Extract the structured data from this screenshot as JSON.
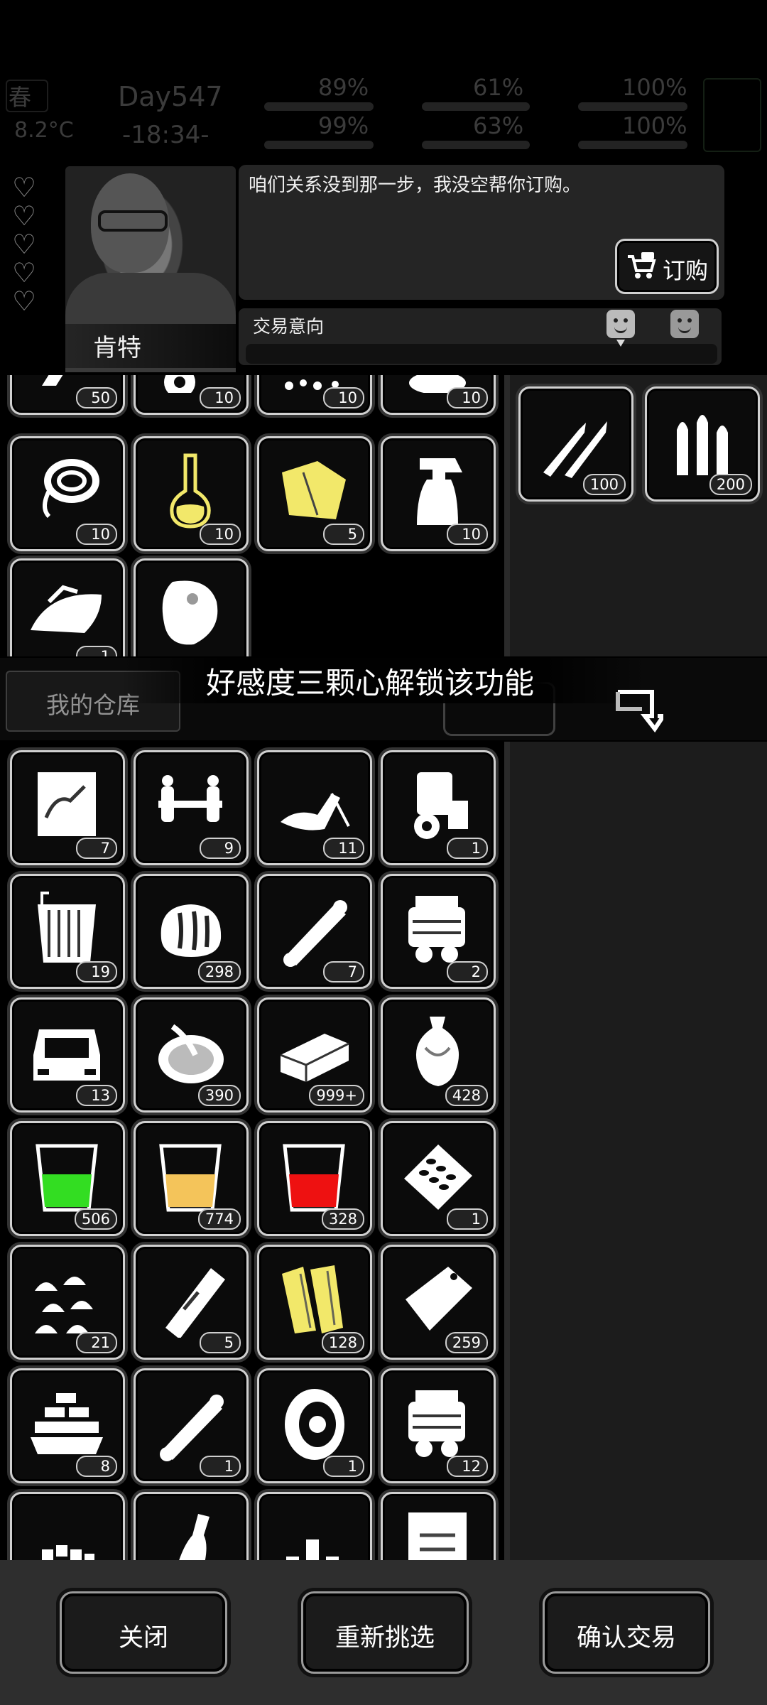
{
  "hud": {
    "season": "春",
    "temperature": "8.2°C",
    "day": "Day547",
    "time": "-18:34-",
    "stats": [
      "89%",
      "61%",
      "100%",
      "99%",
      "63%",
      "100%"
    ]
  },
  "npc": {
    "name": "肯特",
    "hearts_total": 5,
    "dialog": "咱们关系没到那一步，我没空帮你订购。",
    "order_label": "订购",
    "intent_label": "交易意向"
  },
  "npc_items": {
    "counts_top_partial": [
      "50",
      "10",
      "10",
      "10"
    ],
    "row2": [
      {
        "icon": "rope-icon",
        "count": "10"
      },
      {
        "icon": "flask-icon",
        "count": "10"
      },
      {
        "icon": "cloth-icon",
        "count": "5"
      },
      {
        "icon": "spray-bottle-icon",
        "count": "10"
      }
    ],
    "row3": [
      {
        "icon": "iron-icon",
        "count": "1"
      },
      {
        "icon": "meat-icon",
        "count": ""
      }
    ]
  },
  "npc_offer": [
    {
      "icon": "rifle-ammo-icon",
      "count": "100"
    },
    {
      "icon": "bullets-icon",
      "count": "200"
    }
  ],
  "banner": {
    "text": "好感度三颗心解锁该功能",
    "warehouse_label": "我的仓库"
  },
  "my_items": [
    {
      "icon": "blueprint-icon",
      "count": "7"
    },
    {
      "icon": "axle-icon",
      "count": "9"
    },
    {
      "icon": "motorcycle-part-icon",
      "count": "11"
    },
    {
      "icon": "engine-icon",
      "count": "1"
    },
    {
      "icon": "radiator-icon",
      "count": "19"
    },
    {
      "icon": "bread-icon",
      "count": "298"
    },
    {
      "icon": "shock-absorber-icon",
      "count": "7"
    },
    {
      "icon": "v-engine-icon",
      "count": "2"
    },
    {
      "icon": "car-body-icon",
      "count": "13"
    },
    {
      "icon": "soup-bowl-icon",
      "count": "390"
    },
    {
      "icon": "brick-icon",
      "count": "999+"
    },
    {
      "icon": "vase-icon",
      "count": "428"
    },
    {
      "icon": "green-drink-icon",
      "count": "506"
    },
    {
      "icon": "orange-drink-icon",
      "count": "774"
    },
    {
      "icon": "red-drink-icon",
      "count": "328"
    },
    {
      "icon": "pills-icon",
      "count": "1"
    },
    {
      "icon": "dumplings-icon",
      "count": "21"
    },
    {
      "icon": "ticket-icon",
      "count": "5"
    },
    {
      "icon": "wood-planks-icon",
      "count": "128"
    },
    {
      "icon": "bag-icon",
      "count": "259"
    },
    {
      "icon": "gold-bars-icon",
      "count": "8"
    },
    {
      "icon": "shock-absorber-icon",
      "count": "1"
    },
    {
      "icon": "tire-icon",
      "count": "1"
    },
    {
      "icon": "v-engine-icon",
      "count": "12"
    },
    {
      "icon": "sugar-icon",
      "count": ""
    },
    {
      "icon": "bottle-icon",
      "count": ""
    },
    {
      "icon": "cans-icon",
      "count": ""
    },
    {
      "icon": "document-icon",
      "count": ""
    }
  ],
  "buttons": {
    "close": "关闭",
    "reselect": "重新挑选",
    "confirm": "确认交易"
  },
  "colors": {
    "green_drink": "#33dd22",
    "orange_drink": "#f4c45a",
    "red_drink": "#ee1111",
    "cloth": "#f2e86a"
  }
}
